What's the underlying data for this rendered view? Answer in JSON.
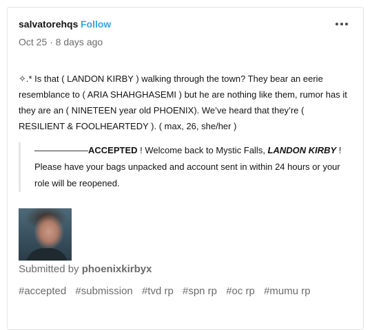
{
  "post": {
    "username": "salvatorehqs",
    "follow_label": "Follow",
    "date": "Oct 25 · 8 days ago",
    "more_icon": "ellipsis-icon",
    "body": "✧.* Is that ( LANDON KIRBY ) walking through the town? They bear an eerie resemblance to ( ARIA SHAHGHASEMI ) but he are nothing like them, rumor has it they are an ( NINETEEN year old PHOENIX). We’ve heard that they’re ( RESILIENT & FOOLHEARTEDY ). ( max, 26, she/her )",
    "quote": {
      "line_prefix": "——————",
      "accepted": "ACCEPTED",
      "middle": " ! Welcome back to Mystic Falls, ",
      "name": "LANDON KIRBY",
      "suffix": " ! Please have your bags unpacked and account sent in within 24 hours or your role will be reopened."
    },
    "submitted_prefix": "Submitted by ",
    "submitted_user": "phoenixkirbyx",
    "tags": [
      "#accepted",
      "#submission",
      "#tvd rp",
      "#spn rp",
      "#oc rp",
      "#mumu rp"
    ]
  }
}
